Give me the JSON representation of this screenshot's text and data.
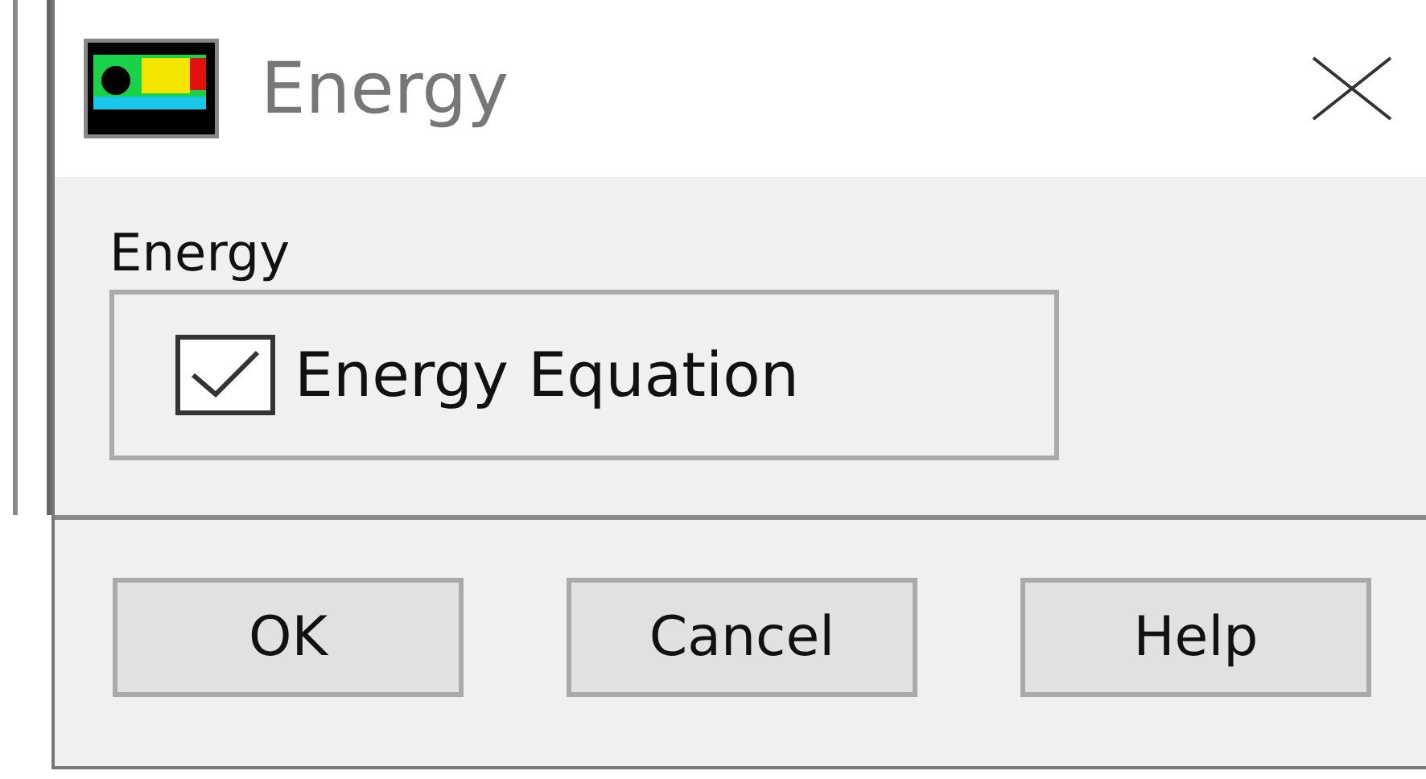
{
  "window": {
    "title": "Energy"
  },
  "group": {
    "label": "Energy"
  },
  "options": [
    {
      "label": "Energy Equation",
      "checked": true
    }
  ],
  "buttons": [
    "OK",
    "Cancel",
    "Help"
  ]
}
